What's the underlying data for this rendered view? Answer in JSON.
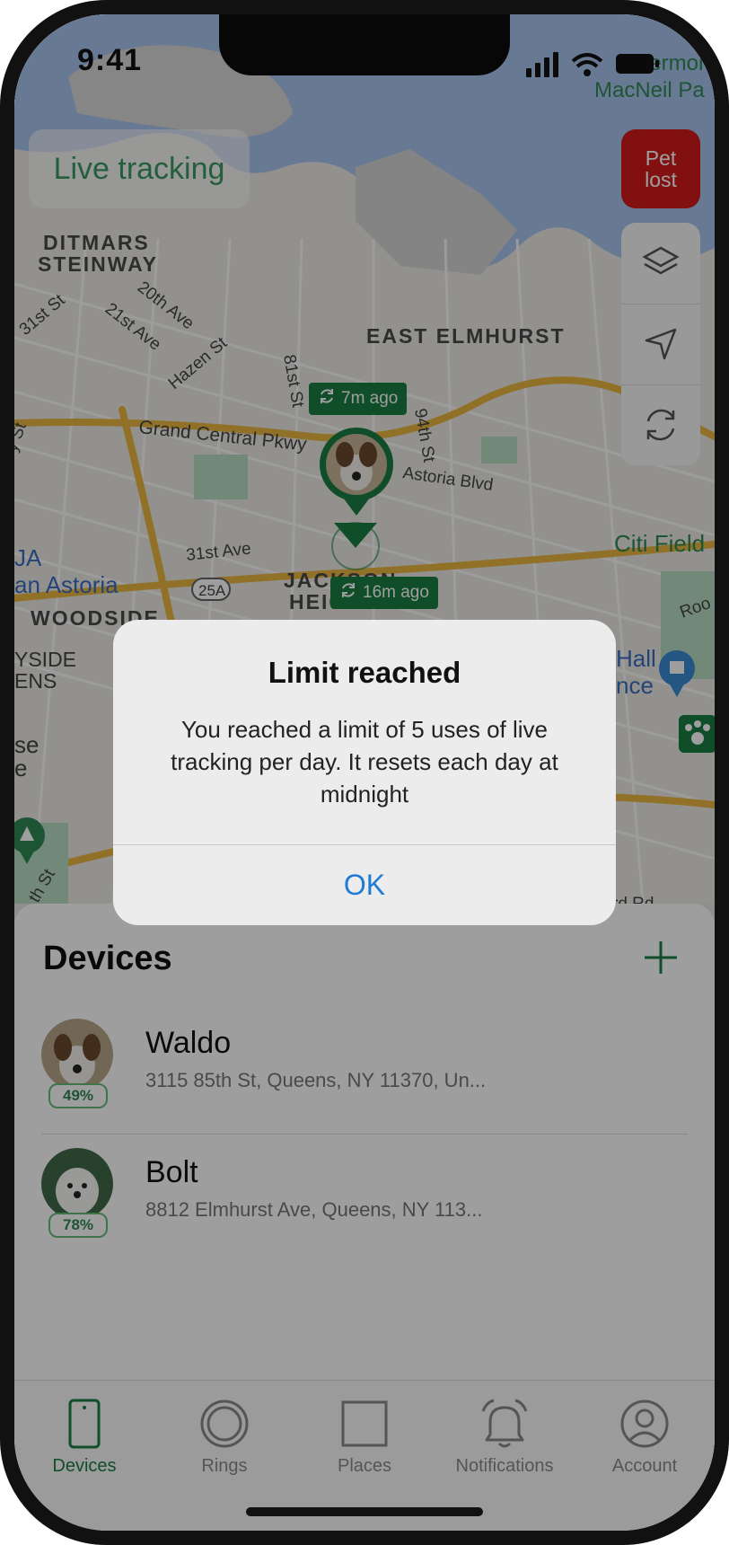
{
  "status": {
    "time": "9:41"
  },
  "map": {
    "live_tracking_label": "Live tracking",
    "pet_lost_label": "Pet lost",
    "badges": [
      {
        "label": "7m ago"
      },
      {
        "label": "16m ago"
      }
    ],
    "places": [
      {
        "label": "DITMARS"
      },
      {
        "label": "STEINWAY"
      },
      {
        "label": "EAST ELMHURST"
      },
      {
        "label": "JACKSON"
      },
      {
        "label": "HEIGHTS"
      },
      {
        "label": "WOODSIDE"
      },
      {
        "label": "Citi Field"
      },
      {
        "label": "Hermon"
      },
      {
        "label": "MacNeil Pa"
      },
      {
        "label": "JA"
      },
      {
        "label": "an Astoria"
      },
      {
        "label": "YSIDE"
      },
      {
        "label": "ENS"
      },
      {
        "label": "Hall"
      },
      {
        "label": "nce"
      },
      {
        "label": "se"
      },
      {
        "label": "e"
      }
    ],
    "streets": [
      {
        "label": "Grand Central Pkwy"
      },
      {
        "label": "Astoria Blvd"
      },
      {
        "label": "31st Ave"
      },
      {
        "label": "31st St"
      },
      {
        "label": "21st Ave"
      },
      {
        "label": "20th Ave"
      },
      {
        "label": "Hazen St"
      },
      {
        "label": "81st St"
      },
      {
        "label": "94th St"
      },
      {
        "label": "25A"
      },
      {
        "label": "Roo"
      },
      {
        "label": "rd Rd"
      },
      {
        "label": "th St"
      },
      {
        "label": "y St"
      }
    ]
  },
  "devices_panel": {
    "title": "Devices",
    "items": [
      {
        "name": "Waldo",
        "address": "3115 85th St, Queens, NY 11370, Un...",
        "battery": "49%"
      },
      {
        "name": "Bolt",
        "address": "8812 Elmhurst Ave, Queens, NY 113...",
        "battery": "78%"
      }
    ]
  },
  "tabs": [
    {
      "label": "Devices",
      "icon": "phone-icon",
      "active": true
    },
    {
      "label": "Rings",
      "icon": "ring-icon"
    },
    {
      "label": "Places",
      "icon": "square-icon"
    },
    {
      "label": "Notifications",
      "icon": "bell-icon"
    },
    {
      "label": "Account",
      "icon": "user-icon"
    }
  ],
  "alert": {
    "title": "Limit reached",
    "message": "You reached a limit of 5 uses of live tracking per day. It resets each day at midnight",
    "ok_label": "OK"
  },
  "colors": {
    "accent": "#1a7c43",
    "danger": "#d21b1b",
    "link": "#1e7bd4"
  }
}
